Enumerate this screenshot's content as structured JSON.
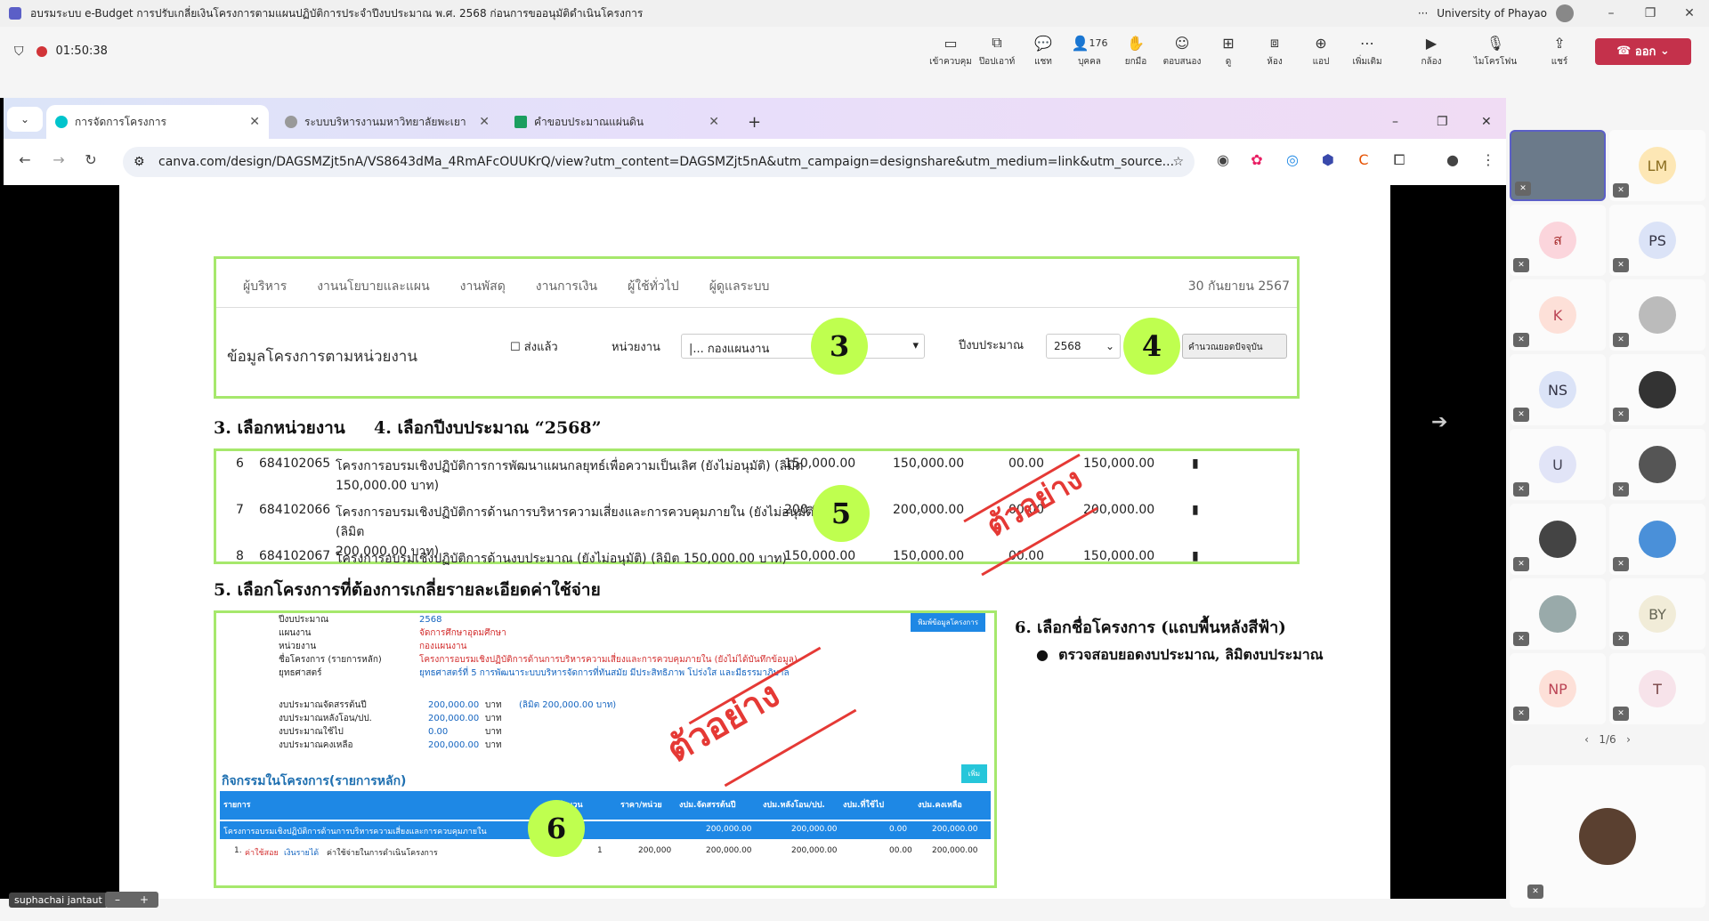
{
  "window": {
    "title": "อบรมระบบ e-Budget การปรับเกลี่ยเงินโครงการตามแผนปฏิบัติการประจำปีงบประมาณ พ.ศ. 2568 ก่อนการขออนุมัติดำเนินโครงการ",
    "more": "···",
    "org": "University of Phayao"
  },
  "meeting": {
    "timer": "01:50:38",
    "tools": [
      "เข้าควบคุม",
      "ป๊อปเอาท์",
      "แชท",
      "บุคคล",
      "ยกมือ",
      "ตอบสนอง",
      "ดู",
      "ห้อง",
      "แอป",
      "เพิ่มเติม",
      "กล้อง",
      "ไมโครโฟน",
      "แชร์"
    ],
    "people_count": "176",
    "leave_label": "ออก"
  },
  "browser": {
    "tabs": [
      "การจัดการโครงการ",
      "ระบบบริหารงานมหาวิทยาลัยพะเยา",
      "คำขอบประมาณแผ่นดิน"
    ],
    "url": "canva.com/design/DAGSMZjt5nA/VS8643dMa_4RmAFcOUUKrQ/view?utm_content=DAGSMZjt5nA&utm_campaign=designshare&utm_medium=link&utm_source..."
  },
  "app": {
    "nav": [
      "ผู้บริหาร",
      "งานนโยบายและแผน",
      "งานพัสดุ",
      "งานการเงิน",
      "ผู้ใช้ทั่วไป",
      "ผู้ดูแลระบบ"
    ],
    "date": "30 กันยายน 2567",
    "section_title": "ข้อมูลโครงการตามหน่วยงาน",
    "sent_label": "ส่งแล้ว",
    "unit_label": "หน่วยงาน",
    "unit_value": "|... กองแผนงาน",
    "year_label": "ปีงบประมาณ",
    "year_value": "2568",
    "calc_button": "คำนวณยอดปัจจุบัน"
  },
  "steps": {
    "s3": "3",
    "s4": "4",
    "s5": "5",
    "s6": "6",
    "h3": "3. เลือกหน่วยงาน",
    "h4": "4. เลือกปีงบประมาณ “2568”",
    "h5": "5. เลือกโครงการที่ต้องการเกลี่ยรายละเอียดค่าใช้จ่าย",
    "h6": "6. เลือกชื่อโครงการ (แถบพื้นหลังสีฟ้า)",
    "bullet": "ตรวจสอบยอดงบประมาณ, ลิมิตงบประมาณ"
  },
  "projects": [
    {
      "no": "6",
      "code": "684102065",
      "name": "โครงการอบรมเชิงปฏิบัติการการพัฒนาแผนกลยุทธ์เพื่อความเป็นเลิศ (ยังไม่อนุมัติ) (ลิมิต",
      "name2": "150,000.00 บาท)",
      "a": "150,000.00",
      "b": "150,000.00",
      "c": "00.00",
      "d": "150,000.00"
    },
    {
      "no": "7",
      "code": "684102066",
      "name": "โครงการอบรมเชิงปฏิบัติการด้านการบริหารความเสี่ยงและการควบคุมภายใน (ยังไม่อนุมัติ) (ลิมิต",
      "name2": "200,000.00 บาท)",
      "a": "200,000.00",
      "b": "200,000.00",
      "c": "00.00",
      "d": "200,000.00"
    },
    {
      "no": "8",
      "code": "684102067",
      "name": "โครงการอบรมเชิงปฏิบัติการด้านงบประมาณ (ยังไม่อนุมัติ) (ลิมิต 150,000.00 บาท)",
      "name2": "",
      "a": "150,000.00",
      "b": "150,000.00",
      "c": "00.00",
      "d": "150,000.00"
    }
  ],
  "stamp": "ตัวอย่าง",
  "detail": {
    "print_btn": "พิมพ์ข้อมูลโครงการ",
    "labels": [
      "ปีงบประมาณ",
      "แผนงาน",
      "หน่วยงาน",
      "ชื่อโครงการ (รายการหลัก)",
      "ยุทธศาสตร์"
    ],
    "values": [
      "2568",
      "จัดการศึกษาอุดมศึกษา",
      "กองแผนงาน",
      "โครงการอบรมเชิงปฏิบัติการด้านการบริหารความเสี่ยงและการควบคุมภายใน (ยังไม่ได้บันทึกข้อมูล)",
      "ยุทธศาสตร์ที่ 5 การพัฒนาระบบบริหารจัดการที่ทันสมัย มีประสิทธิภาพ โปร่งใส และมีธรรมาภิบาล"
    ],
    "budget_labels": [
      "งบประมาณจัดสรรต้นปี",
      "งบประมาณหลังโอน/ปป.",
      "งบประมาณใช้ไป",
      "งบประมาณคงเหลือ"
    ],
    "budget_values": [
      "200,000.00",
      "200,000.00",
      "0.00",
      "200,000.00"
    ],
    "unit": "บาท",
    "limit": "(ลิมิต 200,000.00 บาท)",
    "activities": "กิจกรรมในโครงการ(รายการหลัก)",
    "add_btn": "เพิ่ม",
    "cols": [
      "รายการ",
      "จำนวน",
      "ราคา/หน่วย",
      "งปม.จัดสรรต้นปี",
      "งปม.หลังโอน/ปป.",
      "งปม.ที่ใช้ไป",
      "งปม.คงเหลือ"
    ],
    "main_row": [
      "โครงการอบรมเชิงปฏิบัติการด้านการบริหารความเสี่ยงและการควบคุมภายใน",
      "200,000.00",
      "200,000.00",
      "0.00",
      "200,000.00"
    ],
    "sub_row": [
      "1.",
      "ค่าใช้สอย",
      "เงินรายได้",
      "ค่าใช้จ่ายในการดำเนินโครงการ",
      "1",
      "200,000",
      "200,000.00",
      "200,000.00",
      "00.00",
      "200,000.00"
    ]
  },
  "participants": {
    "tiles": [
      "",
      "LM",
      "ส",
      "PS",
      "K",
      "",
      "NS",
      "",
      "U",
      "",
      "",
      "",
      "",
      "BY",
      "NP",
      "T"
    ],
    "pager": "1/6",
    "presenter": "suphachai jantaut"
  }
}
